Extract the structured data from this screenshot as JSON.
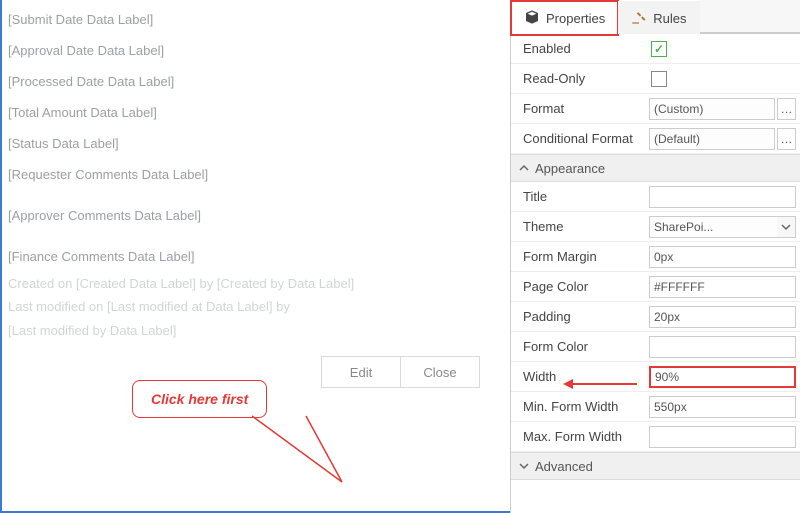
{
  "form": {
    "labels": [
      "[Submit Date Data Label]",
      "[Approval Date Data Label]",
      "[Processed Date Data Label]",
      "[Total Amount Data Label]",
      "[Status Data Label]",
      "[Requester Comments Data Label]",
      "[Approver Comments Data Label]",
      "[Finance Comments Data Label]"
    ],
    "meta_line1_prefix": "Created on",
    "meta_line1_created": "[Created Data Label]",
    "meta_line1_by": "by",
    "meta_line1_createdby": "[Created by Data Label]",
    "meta_line2_prefix": "Last modified on",
    "meta_line2_modat": "[Last modified at Data Label]",
    "meta_line2_by": "by",
    "meta_line3_modby": "[Last modified by Data Label]",
    "buttons": {
      "edit": "Edit",
      "close": "Close"
    }
  },
  "callout": {
    "text": "Click here first"
  },
  "panel": {
    "tabs": {
      "properties": "Properties",
      "rules": "Rules"
    },
    "general": {
      "enabled_label": "Enabled",
      "enabled_checked": true,
      "readonly_label": "Read-Only",
      "readonly_checked": false,
      "format_label": "Format",
      "format_value": "(Custom)",
      "condformat_label": "Conditional Format",
      "condformat_value": "(Default)"
    },
    "appearance": {
      "header": "Appearance",
      "title_label": "Title",
      "title_value": "",
      "theme_label": "Theme",
      "theme_value": "SharePoi...",
      "formmargin_label": "Form Margin",
      "formmargin_value": "0px",
      "pagecolor_label": "Page Color",
      "pagecolor_value": "#FFFFFF",
      "padding_label": "Padding",
      "padding_value": "20px",
      "formcolor_label": "Form Color",
      "formcolor_value": "",
      "width_label": "Width",
      "width_value": "90%",
      "minwidth_label": "Min. Form Width",
      "minwidth_value": "550px",
      "maxwidth_label": "Max. Form Width",
      "maxwidth_value": ""
    },
    "advanced": {
      "header": "Advanced"
    }
  }
}
